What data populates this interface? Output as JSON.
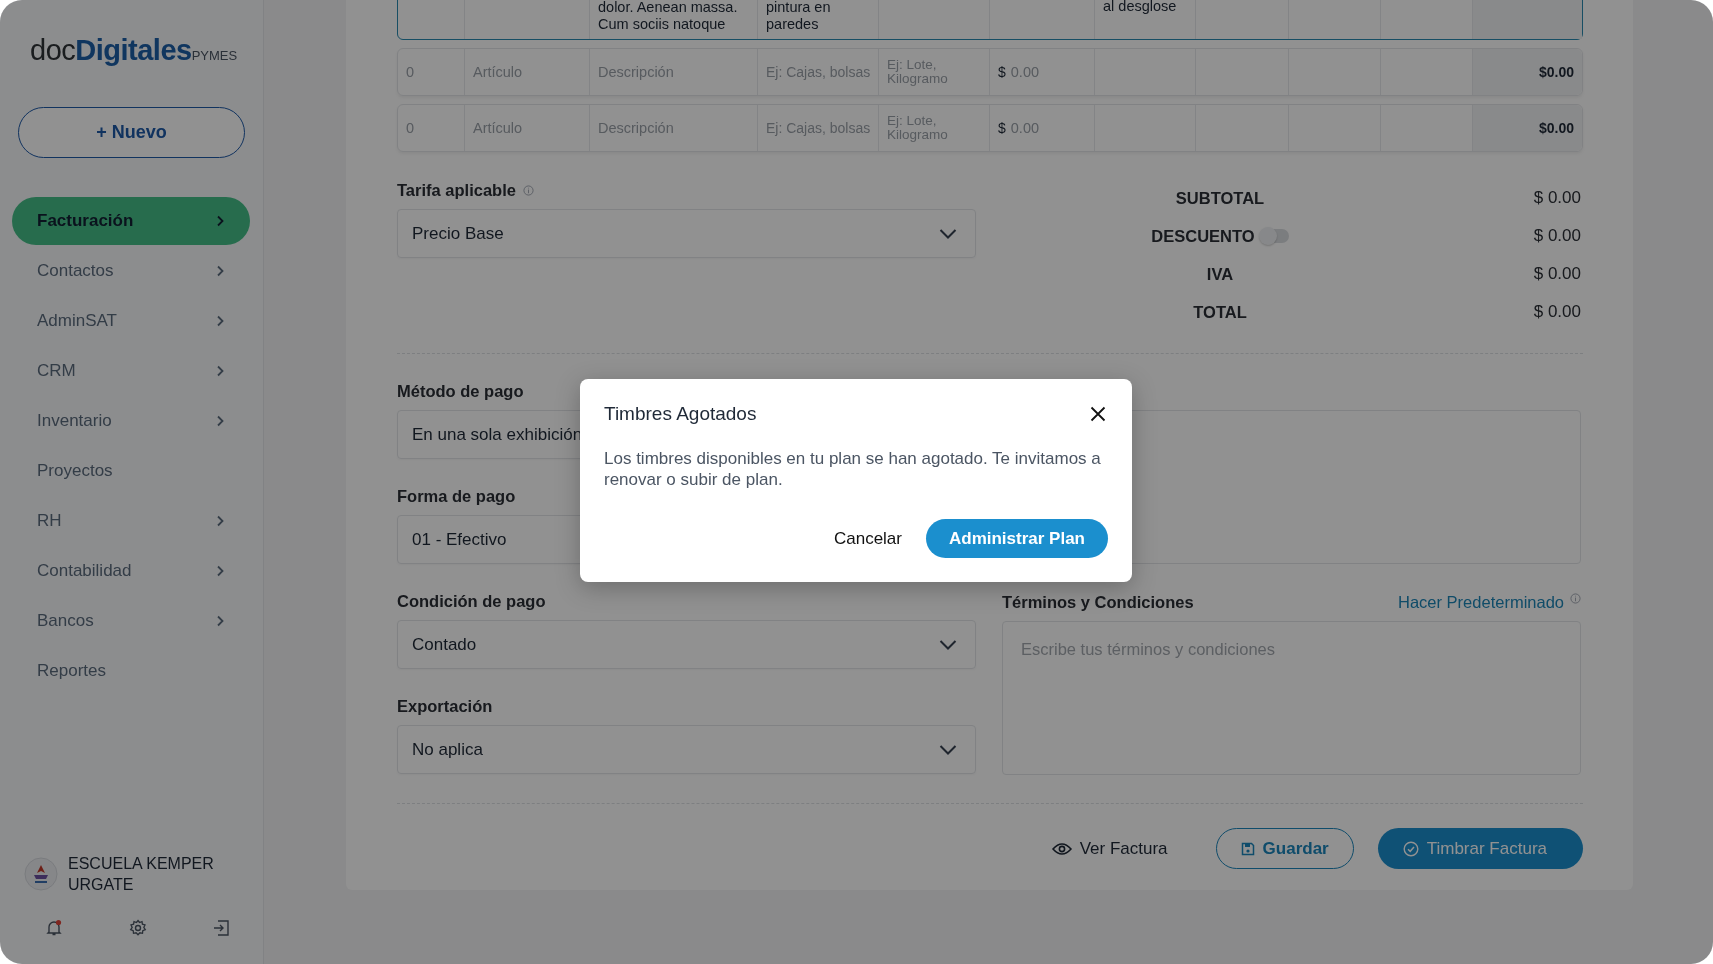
{
  "sidebar": {
    "logo": {
      "prefix": "doc",
      "brand": "Digitales",
      "suffix": "PYMES"
    },
    "new_button": {
      "icon": "+",
      "label": "Nuevo"
    },
    "items": [
      {
        "label": "Facturación",
        "selected": true,
        "has_submenu": true
      },
      {
        "label": "Contactos",
        "selected": false,
        "has_submenu": true
      },
      {
        "label": "AdminSAT",
        "selected": false,
        "has_submenu": true
      },
      {
        "label": "CRM",
        "selected": false,
        "has_submenu": true
      },
      {
        "label": "Inventario",
        "selected": false,
        "has_submenu": true
      },
      {
        "label": "Proyectos",
        "selected": false,
        "has_submenu": false
      },
      {
        "label": "RH",
        "selected": false,
        "has_submenu": true
      },
      {
        "label": "Contabilidad",
        "selected": false,
        "has_submenu": true
      },
      {
        "label": "Bancos",
        "selected": false,
        "has_submenu": true
      },
      {
        "label": "Reportes",
        "selected": false,
        "has_submenu": false
      }
    ],
    "account": {
      "name": "ESCUELA KEMPER URGATE"
    },
    "notifications": {
      "unread": true
    }
  },
  "items_table": {
    "partial_row": {
      "column_3": "dolor. Aenean massa.\nCum sociis natoque",
      "column_4": "pintura en\nparedes",
      "column_7": "al desglose"
    },
    "rows": [
      {
        "quantity_placeholder": "0",
        "article_placeholder": "Artículo",
        "description_placeholder": "Descripción",
        "unit_placeholder": "Ej: Cajas, bolsas",
        "unit_sat_placeholder": "Ej: Lote, Kilogramo",
        "currency": "$",
        "price_placeholder": "0.00",
        "amount": "$0.00"
      },
      {
        "quantity_placeholder": "0",
        "article_placeholder": "Artículo",
        "description_placeholder": "Descripción",
        "unit_placeholder": "Ej: Cajas, bolsas",
        "unit_sat_placeholder": "Ej: Lote, Kilogramo",
        "currency": "$",
        "price_placeholder": "0.00",
        "amount": "$0.00"
      }
    ]
  },
  "rate": {
    "label": "Tarifa aplicable",
    "value": "Precio Base"
  },
  "totals": [
    {
      "kind": "plain",
      "label": "SUBTOTAL",
      "value": "$ 0.00"
    },
    {
      "kind": "toggle",
      "label": "DESCUENTO",
      "on": false,
      "value": "$ 0.00"
    },
    {
      "kind": "plain",
      "label": "IVA",
      "value": "$ 0.00"
    },
    {
      "kind": "plain",
      "label": "TOTAL",
      "value": "$ 0.00"
    }
  ],
  "payment_fields": [
    {
      "label": "Método de pago",
      "value": "En una sola exhibición"
    },
    {
      "label": "Forma de pago",
      "value": "01 - Efectivo"
    },
    {
      "label": "Condición de pago",
      "value": "Contado"
    },
    {
      "label": "Exportación",
      "value": "No aplica"
    }
  ],
  "terms": {
    "label": "Términos y Condiciones",
    "link": "Hacer Predeterminado",
    "placeholder": "Escribe tus términos y condiciones"
  },
  "actions": [
    {
      "kind": "text",
      "label": "Ver Factura"
    },
    {
      "kind": "outline",
      "label": "Guardar"
    },
    {
      "kind": "primary",
      "label": "Timbrar Factura"
    }
  ],
  "modal": {
    "title": "Timbres Agotados",
    "message": "Los timbres disponibles en tu plan se han agotado. Te invitamos a renovar o subir de plan.",
    "buttons": [
      {
        "kind": "text",
        "label": "Cancelar"
      },
      {
        "kind": "primary",
        "label": "Administrar Plan"
      }
    ]
  }
}
